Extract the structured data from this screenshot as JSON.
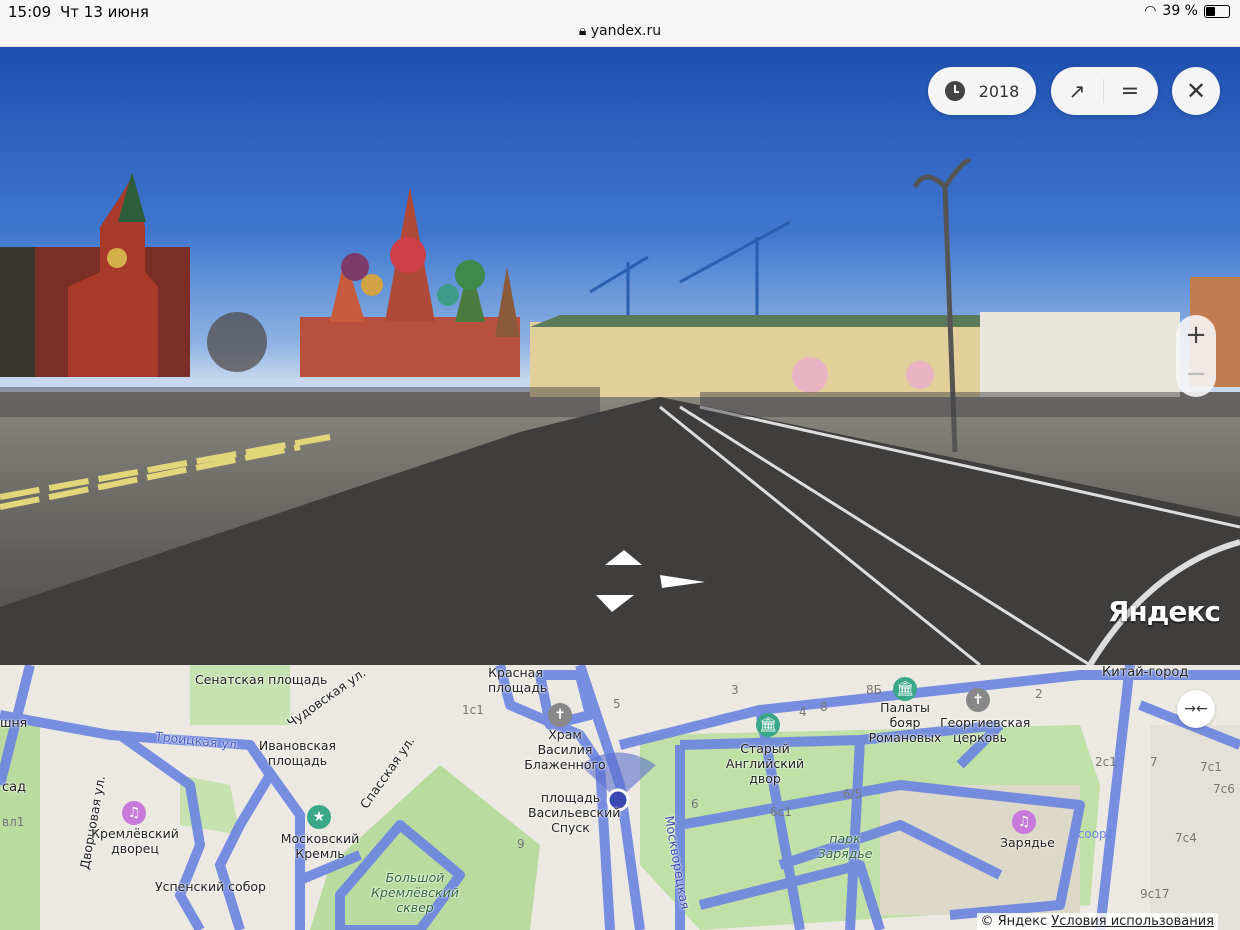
{
  "status_bar": {
    "time": "15:09",
    "date": "Чт 13 июня",
    "url": "yandex.ru",
    "battery": "39 %"
  },
  "panorama": {
    "year": "2018",
    "watermark": "Яндекс",
    "zoom_in": "+",
    "zoom_out": "−"
  },
  "map": {
    "labels": [
      "Сенатская площадь",
      "Ивановская площадь",
      "Троицкая ул.",
      "Чудовская ул.",
      "Спасская ул.",
      "Дворцовая ул.",
      "Кремлёвский дворец",
      "Московский Кремль",
      "Успенский собор",
      "Большой Кремлёвский сквер",
      "Красная площадь",
      "Храм Василия Блаженного",
      "площадь Васильевский Спуск",
      "Москворецкая",
      "Палаты бояр Романовых",
      "Георгиевская церковь",
      "Старый Английский двор",
      "парк Зарядье",
      "Зарядье",
      "Китай-город",
      "сад",
      "шня",
      "вл1"
    ],
    "house_numbers": [
      "1с1",
      "9",
      "5",
      "3",
      "8Б",
      "4",
      "8",
      "6",
      "6с1",
      "6/5",
      "2",
      "2с1",
      "7",
      "7с1",
      "7с6",
      "7с4",
      "9с17",
      "2соор1"
    ],
    "copyright": "© Яндекс",
    "terms": "Условия использования"
  }
}
